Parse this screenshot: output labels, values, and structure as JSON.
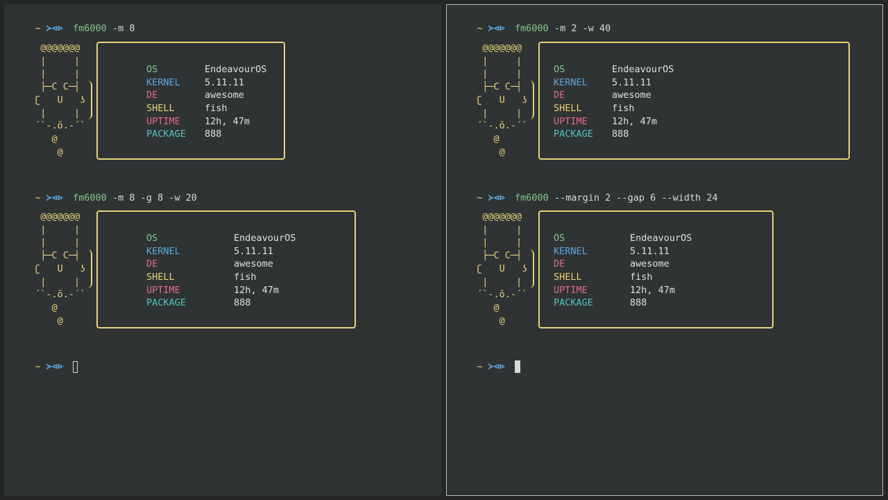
{
  "prompt": {
    "tilde": "~",
    "fish": "≻⊲⊳"
  },
  "panes": [
    {
      "commands": [
        {
          "name": "fm6000",
          "args": "-m 8"
        },
        {
          "name": "fm6000",
          "args": "-m 8 -g 8 -w 20"
        }
      ]
    },
    {
      "commands": [
        {
          "name": "fm6000",
          "args": "-m 2 -w 40"
        },
        {
          "name": "fm6000",
          "args": "--margin 2 --gap 6 --width 24"
        }
      ]
    }
  ],
  "art": "  @@@@@@@\n  |     |\n  |     |\n  ├─C C─┤\n ʗ   U   ʖ\n  |     |\n ´`-.ŏ.-´`\n    @\n     @",
  "info": {
    "os_label": "OS",
    "os_value": "EndeavourOS",
    "kernel_label": "KERNEL",
    "kernel_value": "5.11.11",
    "de_label": "DE",
    "de_value": "awesome",
    "shell_label": "SHELL",
    "shell_value": "fish",
    "uptime_label": "UPTIME",
    "uptime_value": "12h, 47m",
    "package_label": "PACKAGE",
    "package_value": "888"
  },
  "colors": {
    "background": "#2f3334",
    "yellow": "#e8d37b",
    "blue": "#5ea7de",
    "green": "#87c38a",
    "pink": "#e06c8c",
    "teal": "#56c4b8"
  }
}
